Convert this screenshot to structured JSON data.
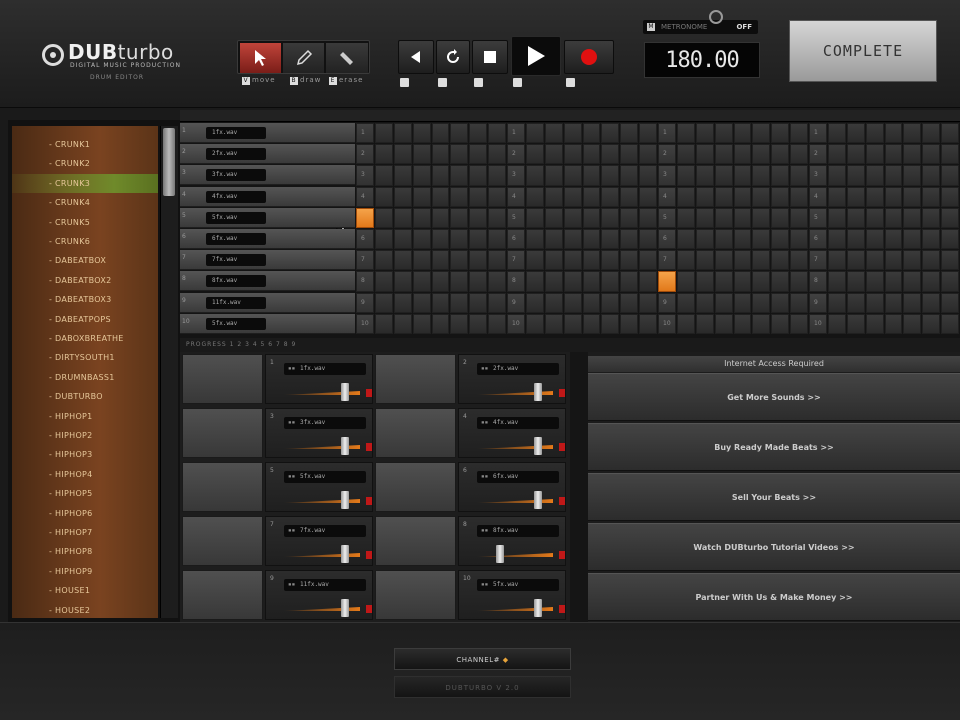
{
  "app": {
    "logo_main": "DUB",
    "logo_accent": "turbo",
    "logo_tag": "DIGITAL MUSIC PRODUCTION",
    "logo_sub": "DRUM EDITOR"
  },
  "tools": [
    {
      "name": "move",
      "key": "V",
      "icon": "arrow-cursor-icon",
      "active": true
    },
    {
      "name": "draw",
      "key": "B",
      "icon": "pencil-icon",
      "active": false
    },
    {
      "name": "erase",
      "key": "E",
      "icon": "eraser-icon",
      "active": false
    }
  ],
  "transport": {
    "rewind_icon": "rewind-icon",
    "loop_icon": "loop-icon",
    "stop_icon": "stop-icon",
    "play_icon": "play-icon",
    "record_icon": "record-icon"
  },
  "metronome": {
    "key": "M",
    "label": "METRONOME",
    "state": "OFF"
  },
  "tempo": "180.00",
  "complete_label": "COMPLETE",
  "sidebar": {
    "items": [
      "- CRUNK1",
      "- CRUNK2",
      "- CRUNK3",
      "- CRUNK4",
      "- CRUNK5",
      "- CRUNK6",
      "- DABEATBOX",
      "- DABEATBOX2",
      "- DABEATBOX3",
      "- DABEATPOPS",
      "- DABOXBREATHE",
      "- DIRTYSOUTH1",
      "- DRUMNBASS1",
      "- DUBTURBO",
      "- HIPHOP1",
      "- HIPHOP2",
      "- HIPHOP3",
      "- HIPHOP4",
      "- HIPHOP5",
      "- HIPHOP6",
      "- HIPHOP7",
      "- HIPHOP8",
      "- HIPHOP9",
      "- HOUSE1",
      "- HOUSE2"
    ],
    "selected_index": 2
  },
  "tracks": [
    {
      "num": "1",
      "name": "1fx.wav"
    },
    {
      "num": "2",
      "name": "2fx.wav"
    },
    {
      "num": "3",
      "name": "3fx.wav"
    },
    {
      "num": "4",
      "name": "4fx.wav"
    },
    {
      "num": "5",
      "name": "5fx.wav"
    },
    {
      "num": "6",
      "name": "6fx.wav"
    },
    {
      "num": "7",
      "name": "7fx.wav"
    },
    {
      "num": "8",
      "name": "8fx.wav"
    },
    {
      "num": "9",
      "name": "11fx.wav"
    },
    {
      "num": "10",
      "name": "5fx.wav"
    }
  ],
  "sequencer": {
    "steps": 32,
    "beat_every": 8,
    "active_cells": [
      [
        4,
        0
      ],
      [
        7,
        16
      ]
    ]
  },
  "status_strip": "PROGRESS 1 2 3 4 5 6 7 8 9",
  "mixer": {
    "channels": [
      {
        "num": "1",
        "name": "1fx.wav",
        "level": 0.8
      },
      {
        "num": "2",
        "name": "2fx.wav",
        "level": 0.8
      },
      {
        "num": "3",
        "name": "3fx.wav",
        "level": 0.8
      },
      {
        "num": "4",
        "name": "4fx.wav",
        "level": 0.8
      },
      {
        "num": "5",
        "name": "5fx.wav",
        "level": 0.8
      },
      {
        "num": "6",
        "name": "6fx.wav",
        "level": 0.8
      },
      {
        "num": "7",
        "name": "7fx.wav",
        "level": 0.8
      },
      {
        "num": "8",
        "name": "8fx.wav",
        "level": 0.3
      },
      {
        "num": "9",
        "name": "11fx.wav",
        "level": 0.8
      },
      {
        "num": "10",
        "name": "5fx.wav",
        "level": 0.8
      }
    ]
  },
  "links": {
    "header": "Internet Access Required",
    "items": [
      "Get More Sounds >>",
      "Buy Ready Made Beats >>",
      "Sell Your Beats >>",
      "Watch DUBturbo Tutorial Videos >>",
      "Partner With Us & Make Money >>"
    ]
  },
  "footer": {
    "channel_label": "CHANNEL#",
    "channel_marker": "◆",
    "version": "DUBTURBO V 2.0"
  },
  "colors": {
    "accent_orange": "#e8831e",
    "record_red": "#e01010",
    "sidebar_brown": "#7a4320",
    "sidebar_selected": "#6f8a2a"
  }
}
